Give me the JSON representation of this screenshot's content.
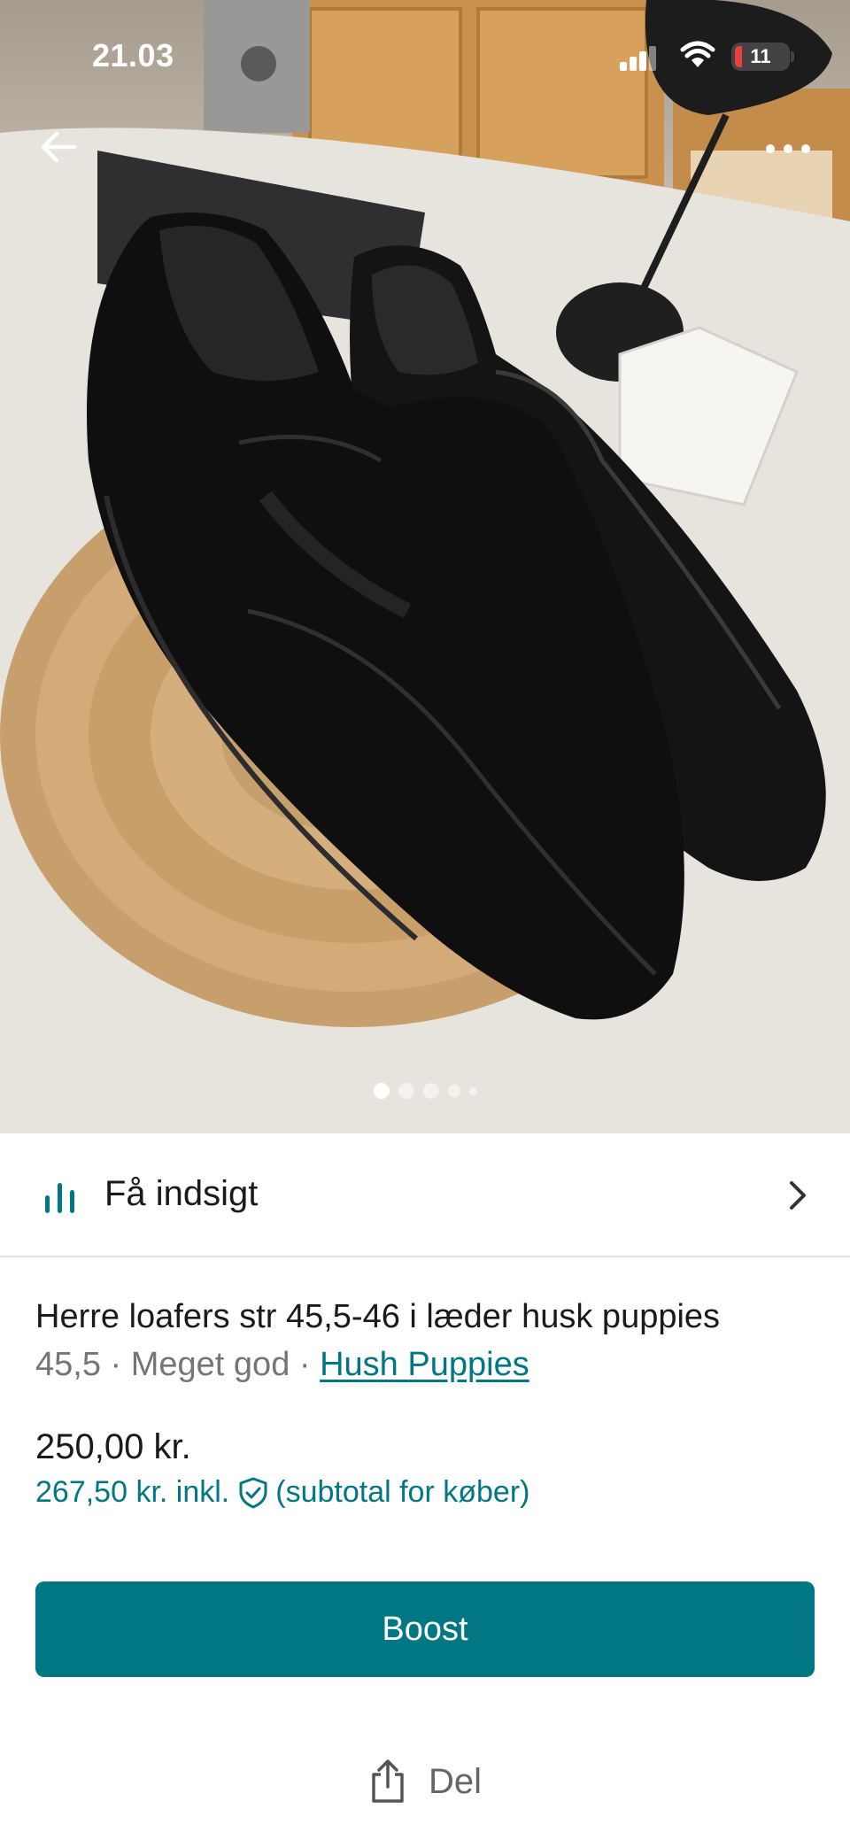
{
  "status_bar": {
    "time": "21.03",
    "battery_level": "11"
  },
  "nav": {
    "back_icon": "arrow-left-icon",
    "more_icon": "more-dots-icon"
  },
  "photo": {
    "subject": "black-leather-loafers",
    "carousel_total": 5,
    "carousel_active": 1
  },
  "insight": {
    "label": "Få indsigt",
    "icon": "bar-chart-icon"
  },
  "item": {
    "title": "Herre loafers str 45,5-46 i læder husk puppies",
    "size": "45,5",
    "separator": " · ",
    "condition": "Meget god",
    "brand": "Hush Puppies",
    "price": "250,00 kr.",
    "price_incl": "267,50 kr. inkl.",
    "price_incl_note": "(subtotal for køber)"
  },
  "actions": {
    "boost_label": "Boost",
    "share_label": "Del"
  },
  "colors": {
    "accent": "#007782",
    "text": "#1a1a1a",
    "muted": "#757575"
  }
}
